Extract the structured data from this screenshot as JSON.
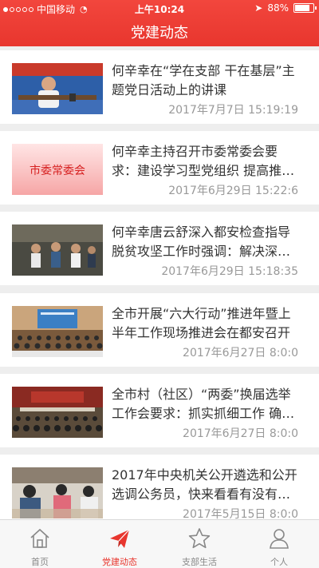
{
  "status_bar": {
    "carrier": "中国移动",
    "time": "上午10:24",
    "battery": "88%",
    "battery_level": 0.88
  },
  "header": {
    "title": "党建动态"
  },
  "thumb_label": "市委常委会",
  "news": [
    {
      "title": "何辛幸在“学在支部 干在基层”主题党日活动上的讲课",
      "date": "2017年7月7日  15:19:19",
      "thumb": "lecture-photo"
    },
    {
      "title": "何辛幸主持召开市委常委会要求：建设学习型党组织 提高推…",
      "date": "2017年6月29日  15:22:6",
      "thumb": "committee-banner"
    },
    {
      "title": "何辛幸唐云舒深入都安检查指导脱贫攻坚工作时强调：解决深…",
      "date": "2017年6月29日  15:18:35",
      "thumb": "inspection-photo"
    },
    {
      "title": "全市开展“六大行动”推进年暨上半年工作现场推进会在都安召开",
      "date": "2017年6月27日  8:0:0",
      "thumb": "meeting-hall-photo"
    },
    {
      "title": "全市村（社区）“两委”换届选举工作会要求：抓实抓细工作 确…",
      "date": "2017年6月27日  8:0:0",
      "thumb": "conference-photo"
    },
    {
      "title": "2017年中央机关公开遴选和公开选调公务员，快来看看有没有…",
      "date": "2017年5月15日  8:0:0",
      "thumb": "exam-photo"
    }
  ],
  "tabs": [
    {
      "label": "首页",
      "icon": "home-icon"
    },
    {
      "label": "党建动态",
      "icon": "paper-plane-icon"
    },
    {
      "label": "支部生活",
      "icon": "star-icon"
    },
    {
      "label": "个人",
      "icon": "person-icon"
    }
  ],
  "colors": {
    "accent": "#e8362e",
    "background": "#eeeeee",
    "tab_inactive": "#888888"
  }
}
